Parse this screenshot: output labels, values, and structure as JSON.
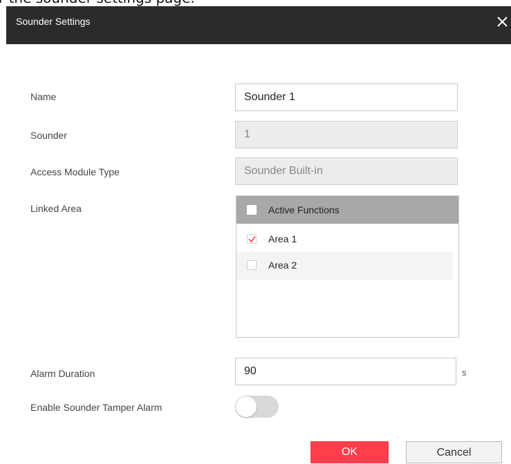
{
  "caption": "r the sounder settings page.",
  "dialog": {
    "title": "Sounder Settings",
    "close_icon": "close-icon"
  },
  "form": {
    "name": {
      "label": "Name",
      "value": "Sounder 1"
    },
    "sounder": {
      "label": "Sounder",
      "value": "1",
      "disabled": true
    },
    "access_module_type": {
      "label": "Access Module Type",
      "value": "Sounder Built-in",
      "disabled": true
    },
    "linked_area": {
      "label": "Linked Area",
      "header": {
        "label": "Active Functions",
        "checked": false
      },
      "items": [
        {
          "label": "Area 1",
          "checked": true
        },
        {
          "label": "Area 2",
          "checked": false
        }
      ]
    },
    "alarm_duration": {
      "label": "Alarm Duration",
      "value": "90",
      "unit": "s"
    },
    "tamper_alarm": {
      "label": "Enable Sounder Tamper Alarm",
      "enabled": false
    }
  },
  "buttons": {
    "ok": "OK",
    "cancel": "Cancel"
  },
  "colors": {
    "title_bar": "#2b2b2b",
    "ok_button": "#ff3e4b",
    "checkmark": "#ff3e4b",
    "header_row": "#a8a8a8"
  }
}
